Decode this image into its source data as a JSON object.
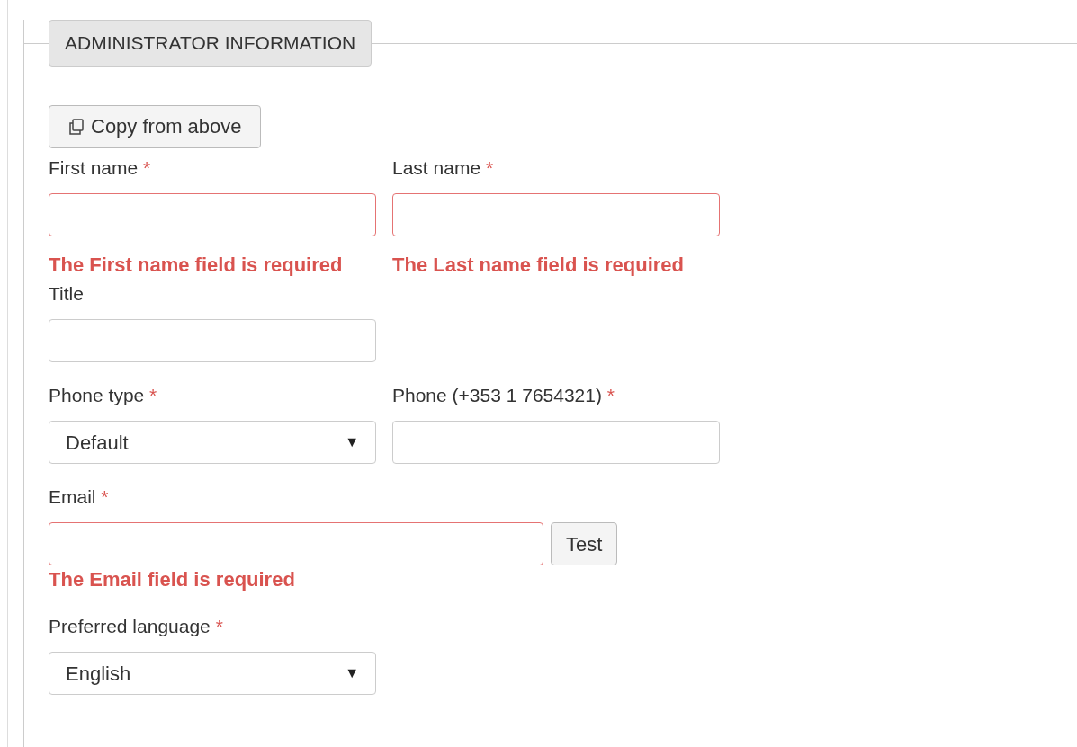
{
  "section": {
    "legend": "ADMINISTRATOR INFORMATION"
  },
  "copy_button": {
    "label": "Copy from above"
  },
  "rows": [
    {
      "fields": [
        {
          "kind": "text",
          "label": "First name",
          "required_mark": "*",
          "invalid": true,
          "error": "The First name field is required"
        },
        {
          "kind": "text",
          "label": "Last name",
          "required_mark": "*",
          "invalid": true,
          "error": "The Last name field is required"
        }
      ]
    },
    {
      "fields": [
        {
          "kind": "text",
          "label": "Title",
          "invalid": false
        }
      ]
    },
    {
      "fields": [
        {
          "kind": "select",
          "label": "Phone type",
          "required_mark": "*",
          "invalid": false,
          "value": "Default",
          "caret": "▼"
        },
        {
          "kind": "text",
          "label": "Phone (+353 1 7654321)",
          "required_mark": "*",
          "invalid": false
        }
      ]
    },
    {
      "fields": [
        {
          "kind": "email",
          "label": "Email",
          "required_mark": "*",
          "invalid": true,
          "error": "The Email field is required",
          "button": "Test"
        }
      ]
    },
    {
      "fields": [
        {
          "kind": "select",
          "label": "Preferred language",
          "required_mark": "*",
          "invalid": false,
          "value": "English",
          "caret": "▼"
        }
      ]
    }
  ]
}
